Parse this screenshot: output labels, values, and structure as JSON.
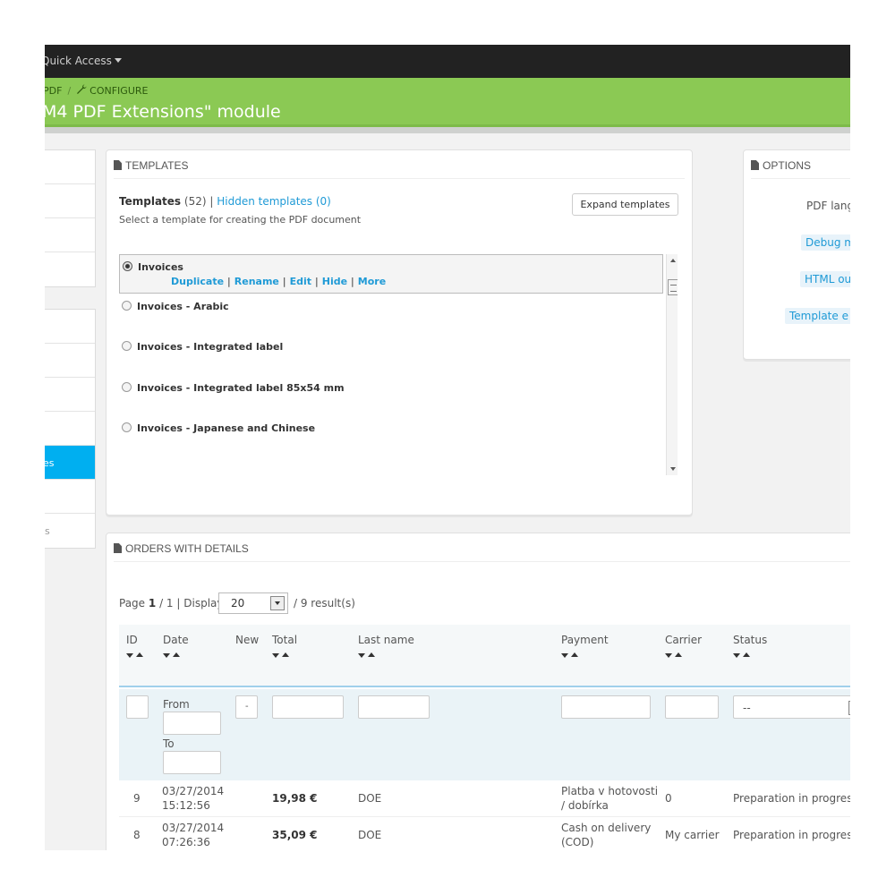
{
  "topbar": {
    "quick_access": "Quick Access"
  },
  "header": {
    "breadcrumb_parent": "PDF",
    "breadcrumb_separator": "/",
    "breadcrumb_current": "CONFIGURE",
    "title": "M4 PDF Extensions\" module"
  },
  "sidebar": {
    "active_label": "es",
    "bottom_label": "s"
  },
  "templates_panel": {
    "heading": "TEMPLATES",
    "count_label": "Templates",
    "count_value": "(52)",
    "count_sep": "|",
    "hidden_link": "Hidden templates (0)",
    "description": "Select a template for creating the PDF document",
    "expand_button": "Expand templates",
    "items": [
      {
        "label": "Invoices",
        "selected": true
      },
      {
        "label": "Invoices - Arabic"
      },
      {
        "label": "Invoices - Integrated label"
      },
      {
        "label": "Invoices - Integrated label 85x54 mm"
      },
      {
        "label": "Invoices - Japanese and Chinese"
      }
    ],
    "actions": {
      "duplicate": "Duplicate",
      "rename": "Rename",
      "edit": "Edit",
      "hide": "Hide",
      "more": "More",
      "sep": "|"
    }
  },
  "options_panel": {
    "heading": "OPTIONS",
    "pdf_language": "PDF lang",
    "debug_mode": "Debug m",
    "html_output": "HTML ou",
    "template_editor": "Template e"
  },
  "orders_panel": {
    "heading": "ORDERS WITH DETAILS",
    "pager": {
      "page_label": "Page",
      "page_current": "1",
      "page_total": "/ 1 |",
      "display_label": "Display",
      "display_value": "20",
      "results": "/ 9 result(s)"
    },
    "columns": [
      "ID",
      "Date",
      "New",
      "Total",
      "Last name",
      "Payment",
      "Carrier",
      "Status"
    ],
    "filters": {
      "from_label": "From",
      "to_label": "To",
      "new_value": "-",
      "status_value": "--"
    },
    "rows": [
      {
        "id": "9",
        "date": "03/27/2014",
        "time": "15:12:56",
        "total": "19,98 €",
        "last_name": "DOE",
        "payment_1": "Platba v hotovosti",
        "payment_2": "/ dobírka",
        "carrier": "0",
        "status": "Preparation in progress"
      },
      {
        "id": "8",
        "date": "03/27/2014",
        "time": "07:26:36",
        "total": "35,09 €",
        "last_name": "DOE",
        "payment_1": "Cash on delivery",
        "payment_2": "(COD)",
        "carrier": "My carrier",
        "status": "Preparation in progress"
      }
    ]
  },
  "colors": {
    "topbar": "#222222",
    "header": "#8bc954",
    "accent": "#00aff0",
    "link": "#1f9ad6"
  }
}
